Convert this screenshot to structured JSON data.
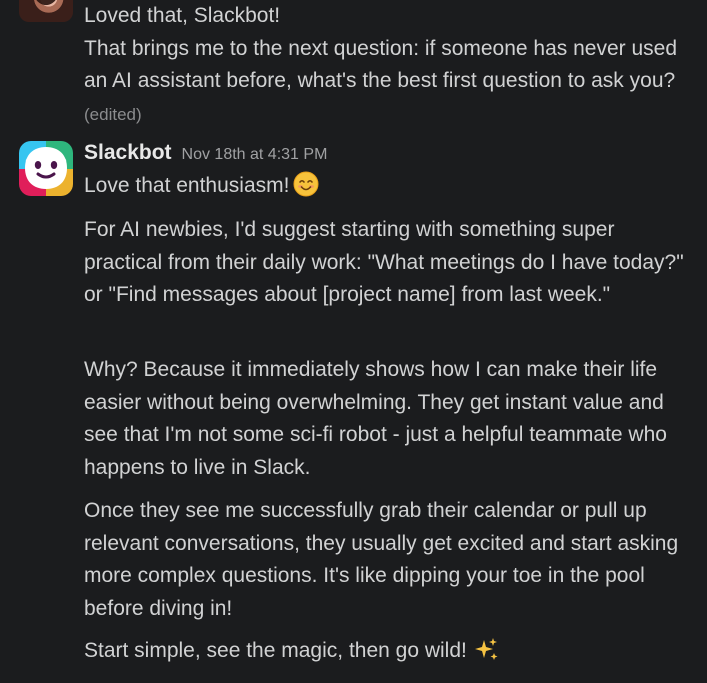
{
  "previous_message": {
    "lines": [
      "Loved that, Slackbot!",
      "That brings me to the next question: if someone has never used an AI assistant before, what's the best first question to ask you?"
    ],
    "edited_label": "(edited)"
  },
  "bot_message": {
    "sender": "Slackbot",
    "timestamp": "Nov 18th at 4:31 PM",
    "greeting": "Love that enthusiasm!",
    "greeting_emoji": "smiling-face-emoji",
    "paragraphs": [
      "For AI newbies, I'd suggest starting with something super practical from their daily work: \"What meetings do I have today?\" or \"Find messages about [project name] from last week.\"",
      "Why? Because it immediately shows how I can make their life easier without being overwhelming. They get instant value and see that I'm not some sci-fi robot - just a helpful teammate who happens to live in Slack.",
      "Once they see me successfully grab their calendar or pull up relevant conversations, they usually get excited and start asking more complex questions. It's like dipping your toe in the pool before diving in!"
    ],
    "closing": "Start simple, see the magic, then go wild!",
    "closing_emoji": "sparkles-emoji"
  },
  "colors": {
    "background": "#1b1c1e",
    "text": "#d1d2d3",
    "muted": "#8b8c8e"
  }
}
